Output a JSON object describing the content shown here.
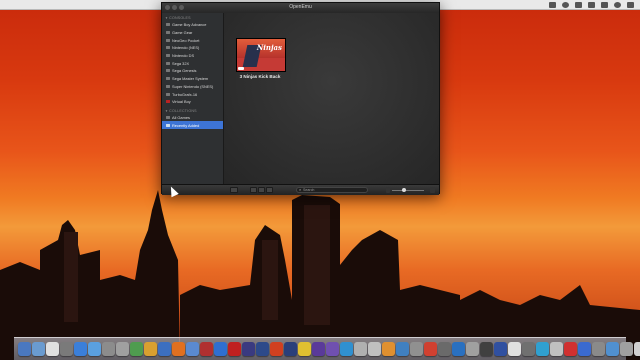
{
  "window": {
    "title": "OpenEmu"
  },
  "sidebar": {
    "consoles_header": "CONSOLES",
    "consoles": [
      {
        "label": "Game Boy Advance",
        "icon": "gba-icon"
      },
      {
        "label": "Game Gear",
        "icon": "gamegear-icon"
      },
      {
        "label": "NeoGeo Pocket",
        "icon": "ngp-icon"
      },
      {
        "label": "Nintendo (NES)",
        "icon": "nes-icon"
      },
      {
        "label": "Nintendo DS",
        "icon": "ds-icon"
      },
      {
        "label": "Sega 32X",
        "icon": "32x-icon"
      },
      {
        "label": "Sega Genesis",
        "icon": "genesis-icon"
      },
      {
        "label": "Sega Master System",
        "icon": "sms-icon"
      },
      {
        "label": "Super Nintendo (SNES)",
        "icon": "snes-icon"
      },
      {
        "label": "TurboGrafx-16",
        "icon": "tg16-icon"
      },
      {
        "label": "Virtual Boy",
        "icon": "virtualboy-icon"
      }
    ],
    "collections_header": "COLLECTIONS",
    "collections": [
      {
        "label": "All Games",
        "icon": "all-games-icon"
      },
      {
        "label": "Recently Added",
        "icon": "recent-icon",
        "selected": true
      }
    ]
  },
  "library": {
    "games": [
      {
        "title": "3 Ninjas Kick Back",
        "boxart_text": "Ninjas"
      }
    ]
  },
  "toolbar": {
    "search_placeholder": "Search"
  },
  "colors": {
    "selection": "#3d74d6",
    "window_bg": "#2a2a2a",
    "sky_top": "#c92a0c",
    "sky_glow": "#f39a3a"
  },
  "dock": {
    "icon_colors": [
      "#4a78c0",
      "#6a9bd0",
      "#e0e0e0",
      "#7a7a7a",
      "#3b7fd9",
      "#5aa0e0",
      "#8c8c8c",
      "#a0a0a0",
      "#4f9c4f",
      "#d9a030",
      "#3c6fc0",
      "#e07020",
      "#5a8ad0",
      "#b03030",
      "#2f6fd0",
      "#c02020",
      "#3a3a80",
      "#2d4a8a",
      "#d04020",
      "#2a3f7a",
      "#e0c030",
      "#5a3a9a",
      "#7050b0",
      "#3090d0",
      "#b0b0b0",
      "#c0c0c0",
      "#e09030",
      "#4080c0",
      "#909090",
      "#d04030",
      "#6a6a6a",
      "#2a70c0",
      "#a0a0a0",
      "#404040",
      "#3050a0",
      "#e0e0e0",
      "#707070",
      "#30a0d0",
      "#c0c0c0",
      "#d03030",
      "#3a6ad0",
      "#8a8a8a",
      "#5090d0",
      "#a0a0a0",
      "#d0d0d0"
    ]
  }
}
